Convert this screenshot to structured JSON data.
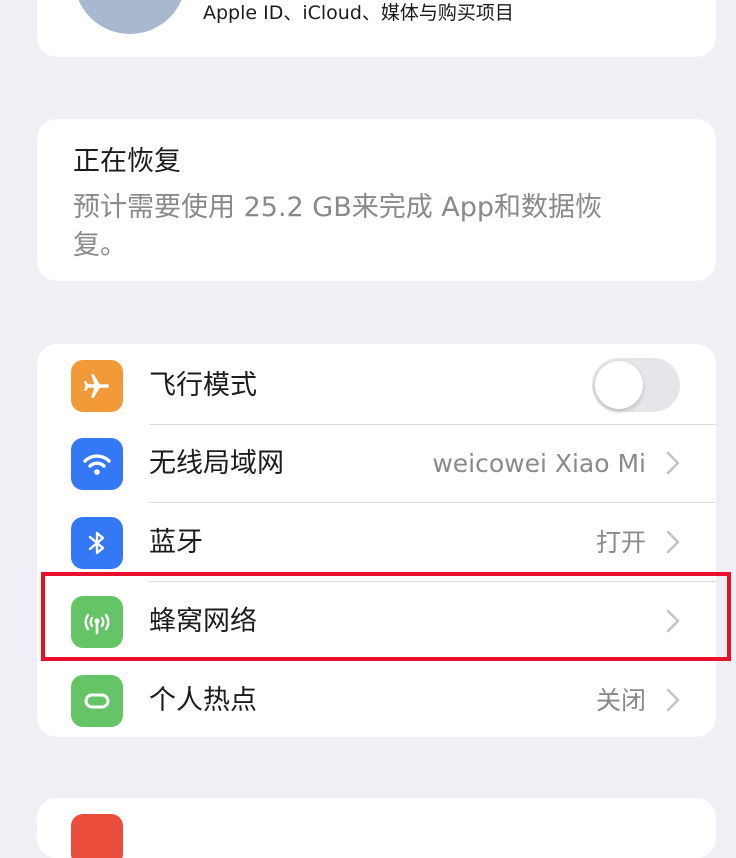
{
  "profile": {
    "subtitle": "Apple ID、iCloud、媒体与购买项目"
  },
  "restore": {
    "title": "正在恢复",
    "description": "预计需要使用 25.2 GB来完成 App和数据恢复。"
  },
  "settings": {
    "airplane": {
      "label": "飞行模式",
      "icon": "airplane-icon",
      "color": "#f19a37",
      "toggle_on": false
    },
    "wifi": {
      "label": "无线局域网",
      "value": "weicowei Xiao Mi",
      "icon": "wifi-icon",
      "color": "#3478f6"
    },
    "bluetooth": {
      "label": "蓝牙",
      "value": "打开",
      "icon": "bluetooth-icon",
      "color": "#3478f6"
    },
    "cellular": {
      "label": "蜂窝网络",
      "value": "",
      "icon": "cellular-antenna-icon",
      "color": "#65c466",
      "highlighted": true
    },
    "hotspot": {
      "label": "个人热点",
      "value": "关闭",
      "icon": "hotspot-icon",
      "color": "#65c466"
    }
  },
  "bottom": {
    "label": "",
    "icon_color": "#eb4d3d"
  },
  "colors": {
    "background": "#f0eff5",
    "highlight_border": "#e8102a"
  }
}
